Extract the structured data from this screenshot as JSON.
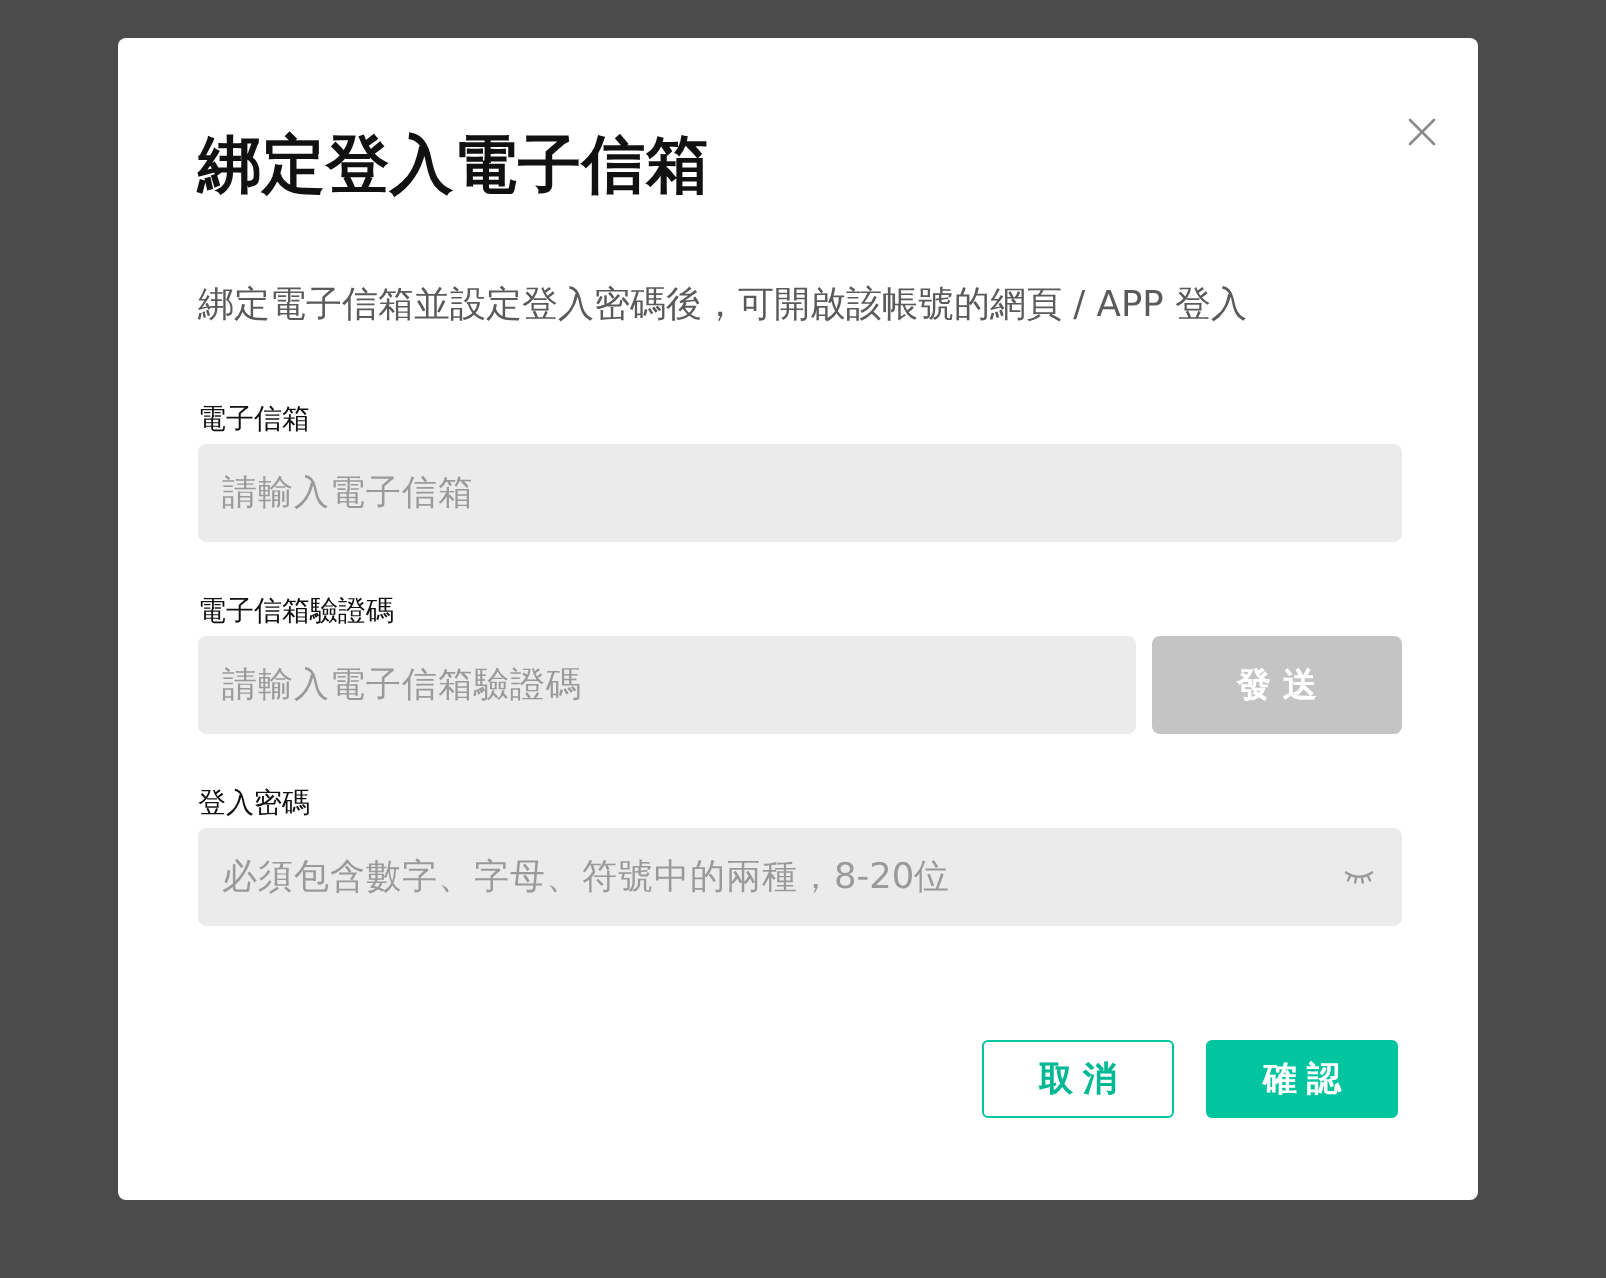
{
  "dialog": {
    "title": "綁定登入電子信箱",
    "description": "綁定電子信箱並設定登入密碼後，可開啟該帳號的網頁 / APP 登入",
    "fields": [
      {
        "kind": "email",
        "label": "電子信箱",
        "placeholder": "請輸入電子信箱"
      },
      {
        "kind": "code",
        "label": "電子信箱驗證碼",
        "placeholder": "請輸入電子信箱驗證碼",
        "send_button": {
          "label": "發送",
          "disabled": true
        }
      },
      {
        "kind": "password",
        "label": "登入密碼",
        "placeholder": "必須包含數字、字母、符號中的兩種，8-20位"
      }
    ],
    "buttons": [
      {
        "kind": "secondary",
        "label": "取消"
      },
      {
        "kind": "primary",
        "label": "確認"
      }
    ]
  }
}
